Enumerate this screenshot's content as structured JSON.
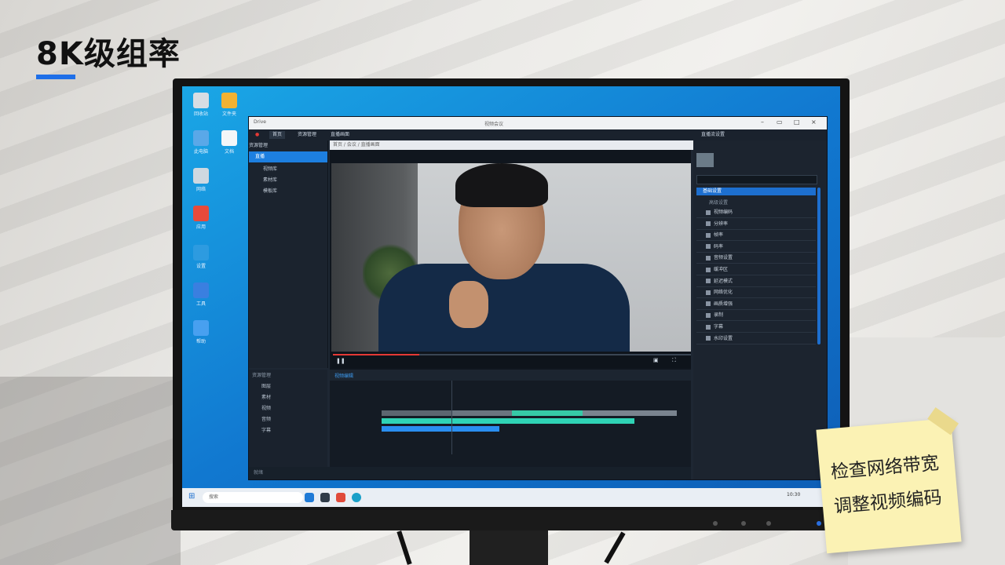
{
  "title": "8K级组率",
  "accent_color": "#1e6fe8",
  "note": {
    "line1": "检查网络带宽",
    "line2": "调整视频编码"
  },
  "desktop_icons": [
    {
      "label": "回收站",
      "icon": "recycle-bin-icon",
      "color": "#d8dde3"
    },
    {
      "label": "文件夹",
      "icon": "folder-icon",
      "color": "#f2b233"
    },
    {
      "label": "此电脑",
      "icon": "computer-icon",
      "color": "#5aa8e8"
    },
    {
      "label": "文档",
      "icon": "document-icon",
      "color": "#f4f6f8"
    },
    {
      "label": "网络",
      "icon": "network-icon",
      "color": "#cfd8e0"
    },
    {
      "label": "应用",
      "icon": "app-icon",
      "color": "#e84a3a"
    },
    {
      "label": "设置",
      "icon": "settings-icon",
      "color": "#2d9be0"
    },
    {
      "label": "工具",
      "icon": "tool-icon",
      "color": "#3a7fe0"
    },
    {
      "label": "帮助",
      "icon": "help-icon",
      "color": "#48a0f0"
    }
  ],
  "window": {
    "app_name": "Drive",
    "window_title": "视频会议",
    "top_tabs": [
      "首页",
      "资源管理"
    ],
    "section_title": "直播画面",
    "left_header": "资源管理",
    "left_items": [
      "直播",
      "视频库",
      "素材库",
      "模板库"
    ],
    "breadcrumb": "首页 / 会议 / 直播画面",
    "timeline_label": "视频编辑",
    "bottom_left_header": "资源管理",
    "bottom_left_items": [
      "图层",
      "素材",
      "视频",
      "音频",
      "字幕"
    ],
    "status_text": "就绪",
    "right_header": "直播流设置",
    "right_tabs": [
      "基础设置",
      "高级设置"
    ],
    "right_rows": [
      "视频编码",
      "分辨率",
      "帧率",
      "码率",
      "音频设置",
      "缓冲区",
      "延迟模式",
      "网络优化",
      "画质增强",
      "录制",
      "字幕",
      "水印设置"
    ]
  },
  "taskbar": {
    "search_placeholder": "搜索",
    "clock": "10:30"
  }
}
